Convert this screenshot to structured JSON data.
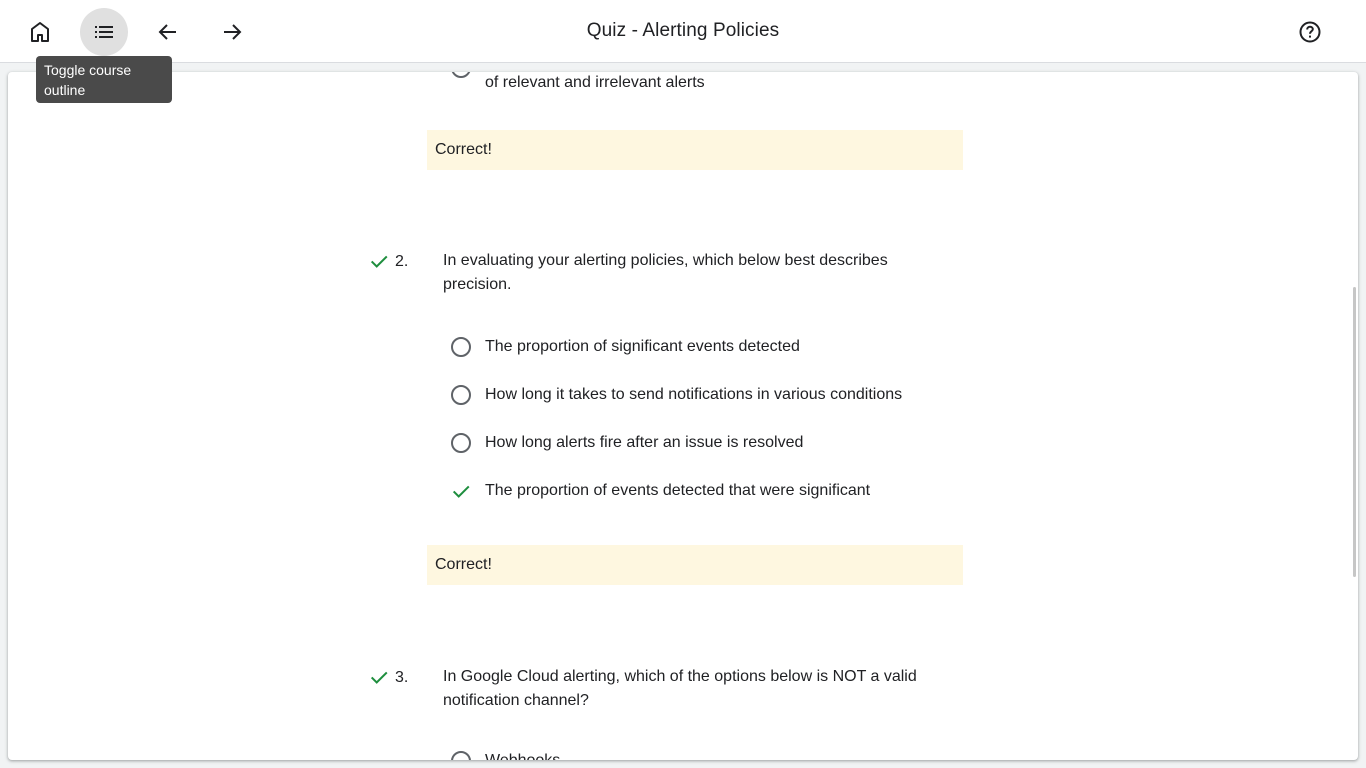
{
  "header": {
    "title": "Quiz - Alerting Policies",
    "tooltip": "Toggle course outline",
    "icons": {
      "home": "home-icon",
      "outline": "list-icon",
      "back": "arrow-back-icon",
      "forward": "arrow-forward-icon",
      "help": "help-icon"
    }
  },
  "colors": {
    "correct": "#1e8e3e",
    "feedback_bg": "#fef7e0"
  },
  "partial_question": {
    "option_text": "of relevant and irrelevant alerts",
    "feedback": "Correct!"
  },
  "questions": [
    {
      "number": "2.",
      "text": "In evaluating your alerting policies, which below best describes precision.",
      "options": [
        {
          "label": "The proportion of significant events detected",
          "selected": false
        },
        {
          "label": "How long it takes to send notifications in various conditions",
          "selected": false
        },
        {
          "label": "How long alerts fire after an issue is resolved",
          "selected": false
        },
        {
          "label": "The proportion of events detected that were significant",
          "selected": true
        }
      ],
      "feedback": "Correct!"
    },
    {
      "number": "3.",
      "text": "In Google Cloud alerting, which of the options below is NOT a valid notification channel?",
      "options": [
        {
          "label": "Webhooks",
          "selected": false
        }
      ]
    }
  ]
}
